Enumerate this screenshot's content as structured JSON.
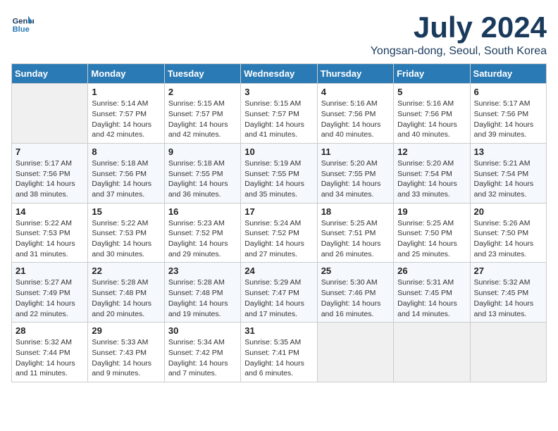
{
  "logo": {
    "line1": "General",
    "line2": "Blue"
  },
  "title": "July 2024",
  "location": "Yongsan-dong, Seoul, South Korea",
  "days_of_week": [
    "Sunday",
    "Monday",
    "Tuesday",
    "Wednesday",
    "Thursday",
    "Friday",
    "Saturday"
  ],
  "weeks": [
    [
      null,
      {
        "num": "1",
        "rise": "5:14 AM",
        "set": "7:57 PM",
        "daylight": "14 hours and 42 minutes."
      },
      {
        "num": "2",
        "rise": "5:15 AM",
        "set": "7:57 PM",
        "daylight": "14 hours and 42 minutes."
      },
      {
        "num": "3",
        "rise": "5:15 AM",
        "set": "7:57 PM",
        "daylight": "14 hours and 41 minutes."
      },
      {
        "num": "4",
        "rise": "5:16 AM",
        "set": "7:56 PM",
        "daylight": "14 hours and 40 minutes."
      },
      {
        "num": "5",
        "rise": "5:16 AM",
        "set": "7:56 PM",
        "daylight": "14 hours and 40 minutes."
      },
      {
        "num": "6",
        "rise": "5:17 AM",
        "set": "7:56 PM",
        "daylight": "14 hours and 39 minutes."
      }
    ],
    [
      {
        "num": "7",
        "rise": "5:17 AM",
        "set": "7:56 PM",
        "daylight": "14 hours and 38 minutes."
      },
      {
        "num": "8",
        "rise": "5:18 AM",
        "set": "7:56 PM",
        "daylight": "14 hours and 37 minutes."
      },
      {
        "num": "9",
        "rise": "5:18 AM",
        "set": "7:55 PM",
        "daylight": "14 hours and 36 minutes."
      },
      {
        "num": "10",
        "rise": "5:19 AM",
        "set": "7:55 PM",
        "daylight": "14 hours and 35 minutes."
      },
      {
        "num": "11",
        "rise": "5:20 AM",
        "set": "7:55 PM",
        "daylight": "14 hours and 34 minutes."
      },
      {
        "num": "12",
        "rise": "5:20 AM",
        "set": "7:54 PM",
        "daylight": "14 hours and 33 minutes."
      },
      {
        "num": "13",
        "rise": "5:21 AM",
        "set": "7:54 PM",
        "daylight": "14 hours and 32 minutes."
      }
    ],
    [
      {
        "num": "14",
        "rise": "5:22 AM",
        "set": "7:53 PM",
        "daylight": "14 hours and 31 minutes."
      },
      {
        "num": "15",
        "rise": "5:22 AM",
        "set": "7:53 PM",
        "daylight": "14 hours and 30 minutes."
      },
      {
        "num": "16",
        "rise": "5:23 AM",
        "set": "7:52 PM",
        "daylight": "14 hours and 29 minutes."
      },
      {
        "num": "17",
        "rise": "5:24 AM",
        "set": "7:52 PM",
        "daylight": "14 hours and 27 minutes."
      },
      {
        "num": "18",
        "rise": "5:25 AM",
        "set": "7:51 PM",
        "daylight": "14 hours and 26 minutes."
      },
      {
        "num": "19",
        "rise": "5:25 AM",
        "set": "7:50 PM",
        "daylight": "14 hours and 25 minutes."
      },
      {
        "num": "20",
        "rise": "5:26 AM",
        "set": "7:50 PM",
        "daylight": "14 hours and 23 minutes."
      }
    ],
    [
      {
        "num": "21",
        "rise": "5:27 AM",
        "set": "7:49 PM",
        "daylight": "14 hours and 22 minutes."
      },
      {
        "num": "22",
        "rise": "5:28 AM",
        "set": "7:48 PM",
        "daylight": "14 hours and 20 minutes."
      },
      {
        "num": "23",
        "rise": "5:28 AM",
        "set": "7:48 PM",
        "daylight": "14 hours and 19 minutes."
      },
      {
        "num": "24",
        "rise": "5:29 AM",
        "set": "7:47 PM",
        "daylight": "14 hours and 17 minutes."
      },
      {
        "num": "25",
        "rise": "5:30 AM",
        "set": "7:46 PM",
        "daylight": "14 hours and 16 minutes."
      },
      {
        "num": "26",
        "rise": "5:31 AM",
        "set": "7:45 PM",
        "daylight": "14 hours and 14 minutes."
      },
      {
        "num": "27",
        "rise": "5:32 AM",
        "set": "7:45 PM",
        "daylight": "14 hours and 13 minutes."
      }
    ],
    [
      {
        "num": "28",
        "rise": "5:32 AM",
        "set": "7:44 PM",
        "daylight": "14 hours and 11 minutes."
      },
      {
        "num": "29",
        "rise": "5:33 AM",
        "set": "7:43 PM",
        "daylight": "14 hours and 9 minutes."
      },
      {
        "num": "30",
        "rise": "5:34 AM",
        "set": "7:42 PM",
        "daylight": "14 hours and 7 minutes."
      },
      {
        "num": "31",
        "rise": "5:35 AM",
        "set": "7:41 PM",
        "daylight": "14 hours and 6 minutes."
      },
      null,
      null,
      null
    ]
  ]
}
